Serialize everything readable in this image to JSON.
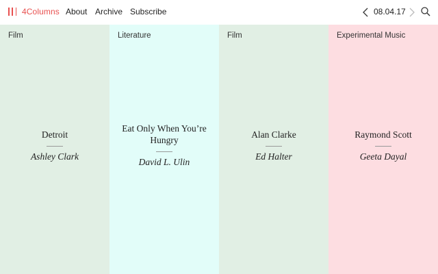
{
  "colors": {
    "brand": "#e8504f",
    "film": "#e1efe4",
    "literature": "#e2fdf9",
    "music": "#fddde1"
  },
  "header": {
    "brand": "4Columns",
    "nav": {
      "about": "About",
      "archive": "Archive",
      "subscribe": "Subscribe"
    },
    "date": "08.04.17",
    "icons": [
      "logo-mark-icon",
      "chevron-left-icon",
      "chevron-right-icon",
      "search-icon"
    ]
  },
  "columns": [
    {
      "category": "Film",
      "title": "Detroit",
      "author": "Ashley Clark",
      "color": "#e1efe4"
    },
    {
      "category": "Literature",
      "title": "Eat Only When You’re Hungry",
      "author": "David L. Ulin",
      "color": "#e2fdf9"
    },
    {
      "category": "Film",
      "title": "Alan Clarke",
      "author": "Ed Halter",
      "color": "#e1efe4"
    },
    {
      "category": "Experimental Music",
      "title": "Raymond Scott",
      "author": "Geeta Dayal",
      "color": "#fddde1"
    }
  ]
}
